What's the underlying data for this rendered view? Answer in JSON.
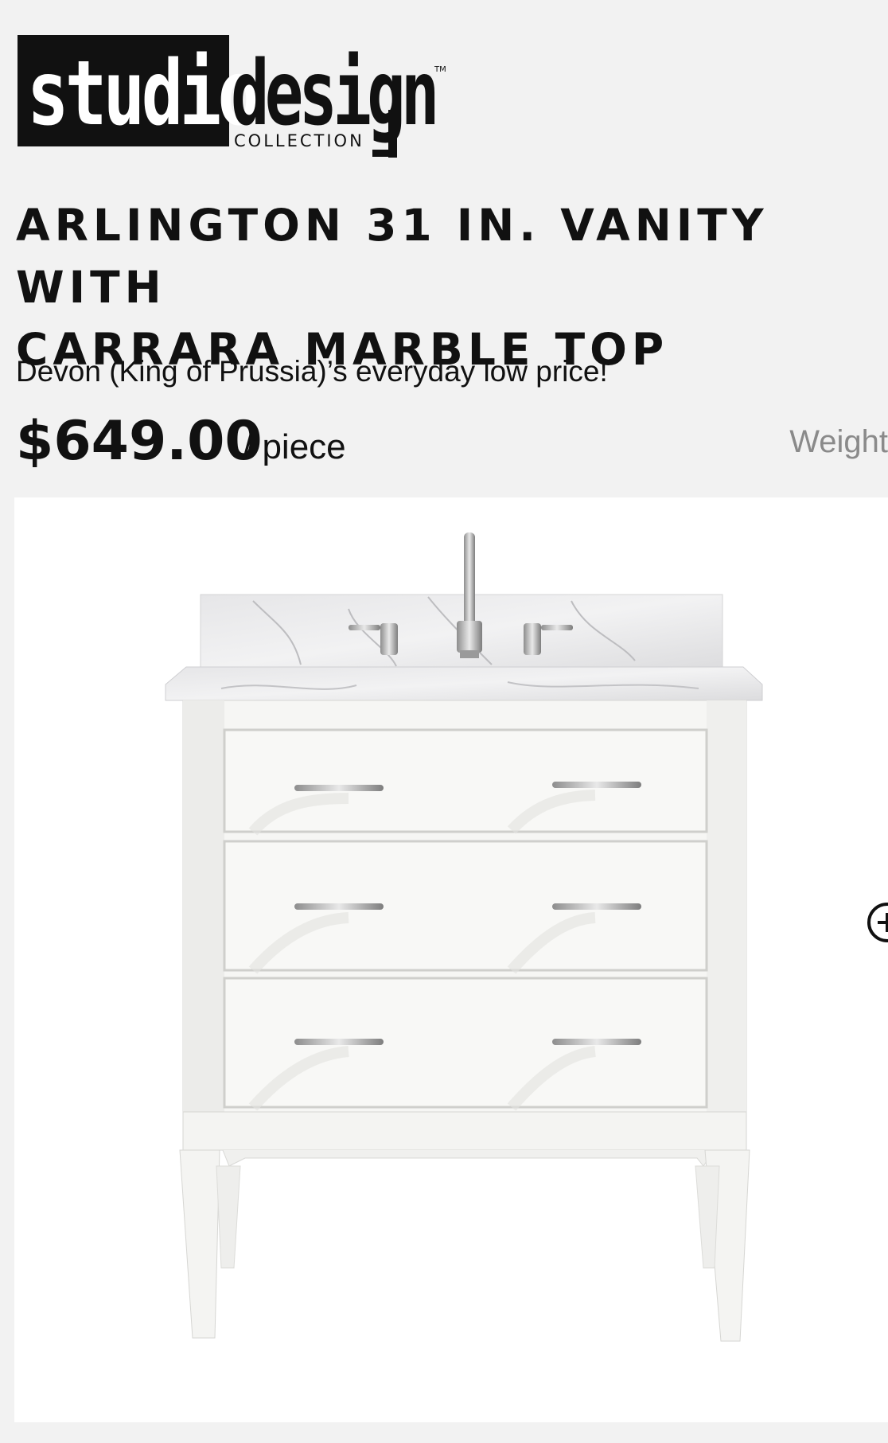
{
  "brand": {
    "part1": "studio",
    "part2": "design",
    "sub": "COLLECTION",
    "tm": "™"
  },
  "product": {
    "title_line1": "ARLINGTON 31 IN. VANITY WITH",
    "title_line2": "CARRARA MARBLE TOP",
    "store_line": "Devon (King of Prussia)’s everyday low price!",
    "price": "$649.00",
    "unit": "/ piece",
    "weight_label": "Weight"
  },
  "image": {
    "alt": "Arlington 31 in. white vanity with Carrara marble top, three drawers and chrome faucet",
    "zoom_icon": "zoom-in-icon"
  },
  "colors": {
    "background": "#f2f2f2",
    "text": "#111111",
    "muted": "#8a8a8a",
    "cabinet": "#f6f6f4"
  }
}
